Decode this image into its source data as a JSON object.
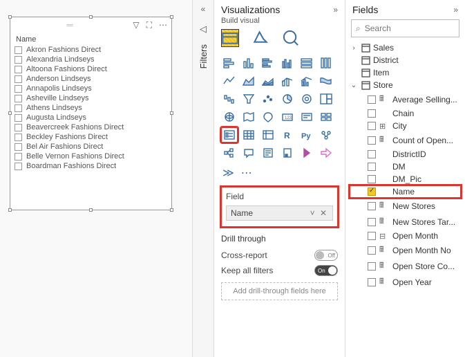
{
  "canvas": {
    "slicer": {
      "title": "Name",
      "items": [
        "Akron Fashions Direct",
        "Alexandria Lindseys",
        "Altoona Fashions Direct",
        "Anderson Lindseys",
        "Annapolis Lindseys",
        "Asheville Lindseys",
        "Athens Lindseys",
        "Augusta Lindseys",
        "Beavercreek Fashions Direct",
        "Beckley Fashions Direct",
        "Bel Air Fashions Direct",
        "Belle Vernon Fashions Direct",
        "Boardman Fashions Direct"
      ]
    }
  },
  "filters": {
    "label": "Filters"
  },
  "viz": {
    "title": "Visualizations",
    "subtitle": "Build visual",
    "field_section": "Field",
    "field_value": "Name",
    "drill": {
      "title": "Drill through",
      "cross": "Cross-report",
      "cross_state": "Off",
      "keep": "Keep all filters",
      "keep_state": "On",
      "drop": "Add drill-through fields here"
    }
  },
  "fields": {
    "title": "Fields",
    "search_placeholder": "Search",
    "tables": {
      "sales": "Sales",
      "district": "District",
      "item": "Item",
      "store": "Store"
    },
    "store_fields": [
      {
        "label": "Average Selling...",
        "checked": false,
        "icon": "measure"
      },
      {
        "label": "Chain",
        "checked": false,
        "icon": "none"
      },
      {
        "label": "City",
        "checked": false,
        "icon": "geo"
      },
      {
        "label": "Count of Open...",
        "checked": false,
        "icon": "measure"
      },
      {
        "label": "DistrictID",
        "checked": false,
        "icon": "none"
      },
      {
        "label": "DM",
        "checked": false,
        "icon": "none"
      },
      {
        "label": "DM_Pic",
        "checked": false,
        "icon": "none"
      },
      {
        "label": "Name",
        "checked": true,
        "icon": "none"
      },
      {
        "label": "New Stores",
        "checked": false,
        "icon": "measure"
      },
      {
        "label": "New Stores Tar...",
        "checked": false,
        "icon": "measure"
      },
      {
        "label": "Open Month",
        "checked": false,
        "icon": "hier"
      },
      {
        "label": "Open Month No",
        "checked": false,
        "icon": "measure"
      },
      {
        "label": "Open Store Co...",
        "checked": false,
        "icon": "measure"
      },
      {
        "label": "Open Year",
        "checked": false,
        "icon": "measure"
      }
    ]
  }
}
